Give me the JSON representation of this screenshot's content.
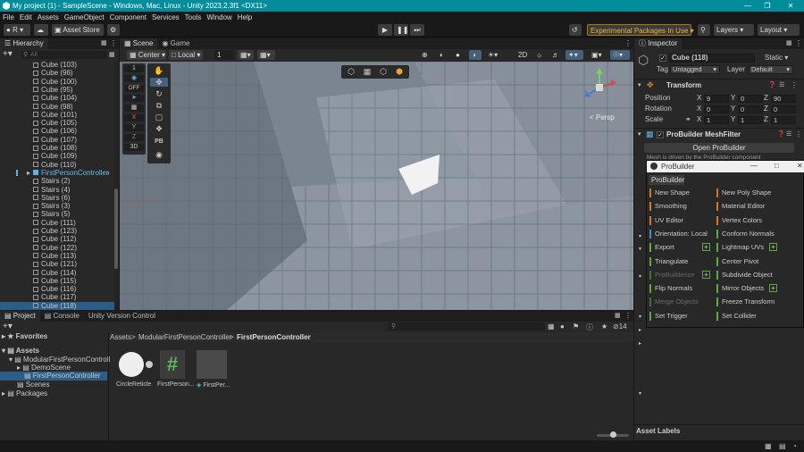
{
  "window": {
    "title": "My project (1) - SampleScene - Windows, Mac, Linux - Unity 2023.2.3f1 <DX11>"
  },
  "menu": [
    "File",
    "Edit",
    "Assets",
    "GameObject",
    "Component",
    "Services",
    "Tools",
    "Window",
    "Help"
  ],
  "toolbar": {
    "account_initial": "R",
    "asset_store": "Asset Store",
    "experimental": "Experimental Packages In Use",
    "layers": "Layers",
    "layout": "Layout"
  },
  "hierarchy": {
    "tab": "Hierarchy",
    "search_placeholder": "All",
    "items": [
      "Cube (103)",
      "Cube (96)",
      "Cube (100)",
      "Cube (95)",
      "Cube (104)",
      "Cube (98)",
      "Cube (101)",
      "Cube (105)",
      "Cube (106)",
      "Cube (107)",
      "Cube (108)",
      "Cube (109)",
      "Cube (110)",
      "FirstPersonController",
      "Stairs (2)",
      "Stairs (4)",
      "Stairs (6)",
      "Stairs (3)",
      "Stairs (5)",
      "Cube (111)",
      "Cube (123)",
      "Cube (112)",
      "Cube (122)",
      "Cube (113)",
      "Cube (121)",
      "Cube (114)",
      "Cube (115)",
      "Cube (116)",
      "Cube (117)",
      "Cube (118)"
    ],
    "selected_index": 29,
    "highlight_index": 13
  },
  "scene": {
    "tabs": [
      "Scene",
      "Game"
    ],
    "pivot": "Center",
    "space": "Local",
    "grid_value": "1",
    "mode_2d": "2D",
    "persp_label": "< Persp",
    "overlay_off": "OFF",
    "overlay_pb": "PB",
    "overlay_labels": [
      "1",
      "X",
      "Y",
      "Z",
      "3D"
    ]
  },
  "inspector": {
    "tab": "Inspector",
    "object_name": "Cube (118)",
    "static_label": "Static",
    "tag_label": "Tag",
    "tag_value": "Untagged",
    "layer_label": "Layer",
    "layer_value": "Default",
    "transform_title": "Transform",
    "position_label": "Position",
    "rotation_label": "Rotation",
    "scale_label": "Scale",
    "axis": [
      "X",
      "Y",
      "Z"
    ],
    "position": [
      "9",
      "0",
      "90"
    ],
    "rotation": [
      "0",
      "0",
      "0"
    ],
    "scale": [
      "1",
      "1",
      "1"
    ],
    "meshfilter_title": "ProBuilder MeshFilter",
    "open_probuilder": "Open ProBuilder",
    "meshfilter_note": "Mesh is driven by the ProBuilder component",
    "asset_labels": "Asset Labels"
  },
  "probuilder": {
    "window_title": "ProBuilder",
    "tab": "ProBuilder",
    "buttons": [
      {
        "label": "New Shape",
        "color": "#d0782a",
        "col": 0,
        "row": 0,
        "enabled": true,
        "plus": false
      },
      {
        "label": "New Poly Shape",
        "color": "#d0782a",
        "col": 1,
        "row": 0,
        "enabled": true,
        "plus": false
      },
      {
        "label": "Smoothing",
        "color": "#d0782a",
        "col": 0,
        "row": 1,
        "enabled": true,
        "plus": false
      },
      {
        "label": "Material Editor",
        "color": "#d0782a",
        "col": 1,
        "row": 1,
        "enabled": true,
        "plus": false
      },
      {
        "label": "UV Editor",
        "color": "#d0782a",
        "col": 0,
        "row": 2,
        "enabled": true,
        "plus": false
      },
      {
        "label": "Vertex Colors",
        "color": "#d0782a",
        "col": 1,
        "row": 2,
        "enabled": true,
        "plus": false
      },
      {
        "label": "Orientation: Local",
        "color": "#3a8fd0",
        "col": 0,
        "row": 3,
        "enabled": true,
        "plus": false
      },
      {
        "label": "Conform Normals",
        "color": "#5caa3a",
        "col": 1,
        "row": 3,
        "enabled": true,
        "plus": false
      },
      {
        "label": "Export",
        "color": "#5caa3a",
        "col": 0,
        "row": 4,
        "enabled": true,
        "plus": true
      },
      {
        "label": "Lightmap UVs",
        "color": "#5caa3a",
        "col": 1,
        "row": 4,
        "enabled": true,
        "plus": true
      },
      {
        "label": "Triangulate",
        "color": "#5caa3a",
        "col": 0,
        "row": 5,
        "enabled": true,
        "plus": false
      },
      {
        "label": "Center Pivot",
        "color": "#5caa3a",
        "col": 1,
        "row": 5,
        "enabled": true,
        "plus": false
      },
      {
        "label": "ProBuilderize",
        "color": "#4a6a3a",
        "col": 0,
        "row": 6,
        "enabled": false,
        "plus": true
      },
      {
        "label": "Subdivide Object",
        "color": "#5caa3a",
        "col": 1,
        "row": 6,
        "enabled": true,
        "plus": false
      },
      {
        "label": "Flip Normals",
        "color": "#5caa3a",
        "col": 0,
        "row": 7,
        "enabled": true,
        "plus": false
      },
      {
        "label": "Mirror Objects",
        "color": "#5caa3a",
        "col": 1,
        "row": 7,
        "enabled": true,
        "plus": true
      },
      {
        "label": "Merge Objects",
        "color": "#4a6a3a",
        "col": 0,
        "row": 8,
        "enabled": false,
        "plus": false
      },
      {
        "label": "Freeze Transform",
        "color": "#5caa3a",
        "col": 1,
        "row": 8,
        "enabled": true,
        "plus": false
      },
      {
        "label": "Set Trigger",
        "color": "#5caa3a",
        "col": 0,
        "row": 9,
        "enabled": true,
        "plus": false
      },
      {
        "label": "Set Collider",
        "color": "#5caa3a",
        "col": 1,
        "row": 9,
        "enabled": true,
        "plus": false
      }
    ]
  },
  "project": {
    "tabs": [
      "Project",
      "Console",
      "Unity Version Control"
    ],
    "favorites": "Favorites",
    "assets_root": "Assets",
    "tree": [
      "ModularFirstPersonControll",
      "DemoScene",
      "FirstPersonController",
      "Scenes",
      "Packages"
    ],
    "breadcrumb": [
      "Assets",
      "ModularFirstPersonController",
      "FirstPersonController"
    ],
    "files": [
      "CircleReticle",
      "FirstPerson...",
      "FirstPer..."
    ],
    "hidden_count": "14"
  }
}
